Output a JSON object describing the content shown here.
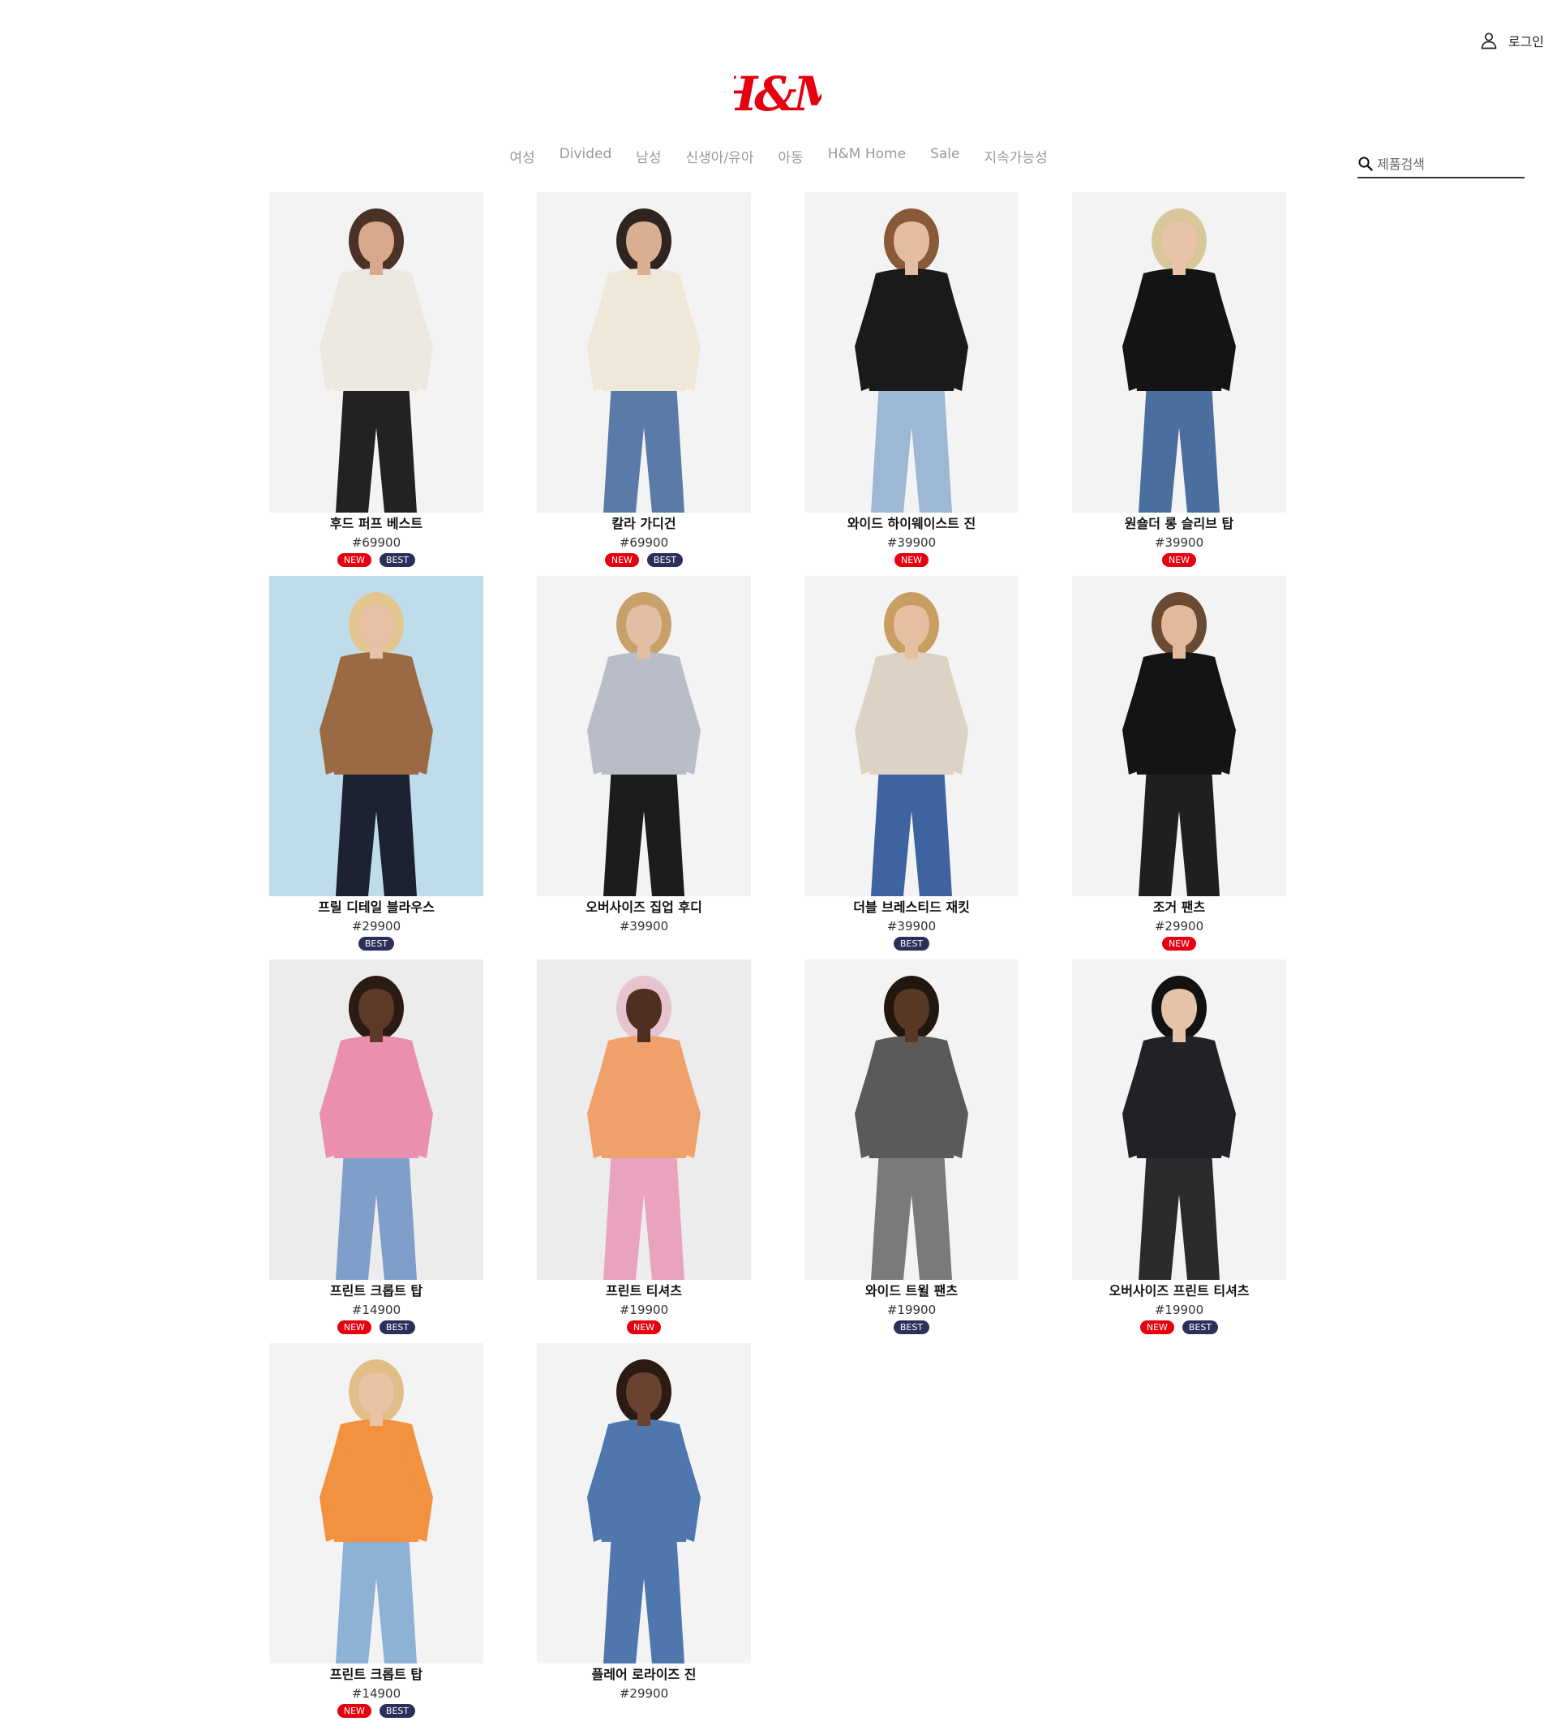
{
  "header": {
    "login_label": "로그인",
    "logo_text": "H&M",
    "brand_color": "#e50010"
  },
  "nav": {
    "items": [
      "여성",
      "Divided",
      "남성",
      "신생아/유아",
      "아동",
      "H&M Home",
      "Sale",
      "지속가능성"
    ]
  },
  "search": {
    "placeholder": "제품검색",
    "value": ""
  },
  "products": [
    {
      "name": "후드 퍼프 베스트",
      "price": "#69900",
      "badges": [
        "NEW",
        "BEST"
      ],
      "image": {
        "bg": "#f3f3f3",
        "top": "#ece8df",
        "bottom": "#222222",
        "skin": "#d7a88a",
        "hair": "#4a3226"
      }
    },
    {
      "name": "칼라 가디건",
      "price": "#69900",
      "badges": [
        "NEW",
        "BEST"
      ],
      "image": {
        "bg": "#f3f3f3",
        "top": "#efe7d8",
        "bottom": "#5a7aa8",
        "skin": "#d9ae92",
        "hair": "#2f241f"
      }
    },
    {
      "name": "와이드 하이웨이스트 진",
      "price": "#39900",
      "badges": [
        "NEW"
      ],
      "image": {
        "bg": "#f3f3f3",
        "top": "#1a1a1a",
        "bottom": "#9db8d4",
        "skin": "#e4bca1",
        "hair": "#8a5a38"
      }
    },
    {
      "name": "원숄더 롱 슬리브 탑",
      "price": "#39900",
      "badges": [
        "NEW"
      ],
      "image": {
        "bg": "#f3f3f3",
        "top": "#141414",
        "bottom": "#4a6e9e",
        "skin": "#e8c4aa",
        "hair": "#d9c79c"
      }
    },
    {
      "name": "프릴 디테일 블라우스",
      "price": "#29900",
      "badges": [
        "BEST"
      ],
      "image": {
        "bg": "#bfdcea",
        "top": "#9a6a44",
        "bottom": "#1d2233",
        "skin": "#e8c0a6",
        "hair": "#e3c58f"
      }
    },
    {
      "name": "오버사이즈 집업 후디",
      "price": "#39900",
      "badges": [],
      "image": {
        "bg": "#f3f3f3",
        "top": "#b9bdc7",
        "bottom": "#1c1c1c",
        "skin": "#e4bea3",
        "hair": "#c7a06a"
      }
    },
    {
      "name": "더블 브레스티드 재킷",
      "price": "#39900",
      "badges": [
        "BEST"
      ],
      "image": {
        "bg": "#f3f3f3",
        "top": "#ddd3c4",
        "bottom": "#3e63a0",
        "skin": "#e6bea0",
        "hair": "#c99e62"
      }
    },
    {
      "name": "조거 팬츠",
      "price": "#29900",
      "badges": [
        "NEW"
      ],
      "image": {
        "bg": "#f3f3f3",
        "top": "#141414",
        "bottom": "#1f1f1f",
        "skin": "#e2b99c",
        "hair": "#6b4a33"
      }
    },
    {
      "name": "프린트 크롭트 탑",
      "price": "#14900",
      "badges": [
        "NEW",
        "BEST"
      ],
      "image": {
        "bg": "#ececec",
        "top": "#ea8fb0",
        "bottom": "#7f9fca",
        "skin": "#5e3a28",
        "hair": "#2a1b13"
      }
    },
    {
      "name": "프린트 티셔츠",
      "price": "#19900",
      "badges": [
        "NEW"
      ],
      "image": {
        "bg": "#ececec",
        "top": "#f0a06a",
        "bottom": "#e9a3be",
        "skin": "#4e2f22",
        "hair": "#e7c3cf"
      }
    },
    {
      "name": "와이드 트윌 팬츠",
      "price": "#19900",
      "badges": [
        "BEST"
      ],
      "image": {
        "bg": "#f3f3f3",
        "top": "#5a5a5a",
        "bottom": "#7a7a7a",
        "skin": "#5a3826",
        "hair": "#22170f"
      }
    },
    {
      "name": "오버사이즈 프린트 티셔츠",
      "price": "#19900",
      "badges": [
        "NEW",
        "BEST"
      ],
      "image": {
        "bg": "#f3f3f3",
        "top": "#202226",
        "bottom": "#2b2b2b",
        "skin": "#e6c2a6",
        "hair": "#121212"
      }
    },
    {
      "name": "프린트 크롭트 탑",
      "price": "#14900",
      "badges": [
        "NEW",
        "BEST"
      ],
      "image": {
        "bg": "#f3f3f3",
        "top": "#f2913e",
        "bottom": "#8eb1d6",
        "skin": "#e8c3a6",
        "hair": "#e2be86"
      }
    },
    {
      "name": "플레어 로라이즈 진",
      "price": "#29900",
      "badges": [],
      "image": {
        "bg": "#f3f3f3",
        "top": "#4f76ad",
        "bottom": "#4f76ad",
        "skin": "#6a4330",
        "hair": "#2a1b13"
      }
    }
  ]
}
